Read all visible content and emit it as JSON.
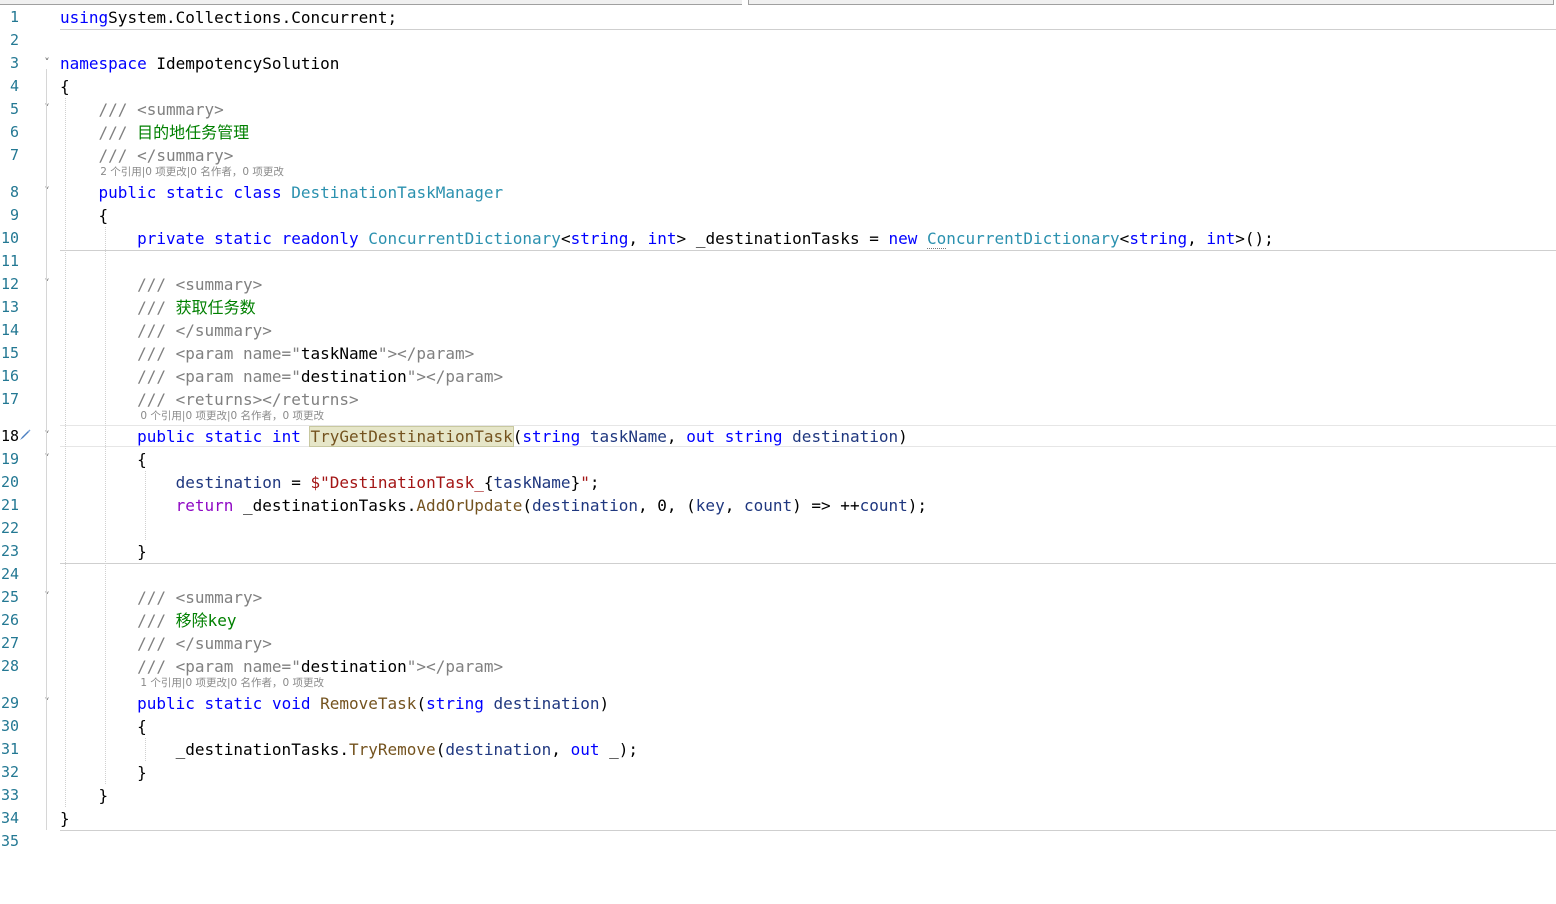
{
  "editor": {
    "current_line": 18,
    "lines": [
      {
        "n": "1",
        "tokens": [
          [
            "kw",
            "using"
          ],
          [
            "",
            "System.Collections.Concurrent;"
          ]
        ]
      },
      {
        "n": "2",
        "tokens": []
      },
      {
        "n": "3",
        "fold": true,
        "tokens": [
          [
            "kw",
            "namespace"
          ],
          [
            "",
            " IdempotencySolution"
          ]
        ]
      },
      {
        "n": "4",
        "tokens": [
          [
            "",
            "{"
          ]
        ]
      },
      {
        "n": "5",
        "fold": true,
        "tokens": [
          [
            "",
            "    "
          ],
          [
            "dx",
            "/// <summary>"
          ]
        ]
      },
      {
        "n": "6",
        "tokens": [
          [
            "",
            "    "
          ],
          [
            "dx",
            "/// "
          ],
          [
            "cm",
            "目的地任务管理"
          ]
        ]
      },
      {
        "n": "7",
        "tokens": [
          [
            "",
            "    "
          ],
          [
            "dx",
            "/// </summary>"
          ]
        ]
      },
      {
        "n": "8",
        "fold": true,
        "lens": "2 个引用|0 项更改|0 名作者，0 项更改",
        "lens_indent": 4,
        "tokens": [
          [
            "",
            "    "
          ],
          [
            "kw",
            "public"
          ],
          [
            "",
            " "
          ],
          [
            "kw",
            "static"
          ],
          [
            "",
            " "
          ],
          [
            "kw",
            "class"
          ],
          [
            "",
            " "
          ],
          [
            "ty",
            "DestinationTaskManager"
          ]
        ]
      },
      {
        "n": "9",
        "tokens": [
          [
            "",
            "    {"
          ]
        ]
      },
      {
        "n": "10",
        "tokens": [
          [
            "",
            "        "
          ],
          [
            "kw",
            "private"
          ],
          [
            "",
            " "
          ],
          [
            "kw",
            "static"
          ],
          [
            "",
            " "
          ],
          [
            "kw",
            "readonly"
          ],
          [
            "",
            " "
          ],
          [
            "ty",
            "ConcurrentDictionary"
          ],
          [
            "",
            "<"
          ],
          [
            "kw",
            "string"
          ],
          [
            ", "
          ],
          [
            "kw",
            "int"
          ],
          [
            "",
            "> _destinationTasks = "
          ],
          [
            "kw",
            "new"
          ],
          [
            "",
            " "
          ],
          [
            "ty squig",
            "Co"
          ],
          [
            "ty",
            "ncurrentDictionary"
          ],
          [
            "",
            "<"
          ],
          [
            "kw",
            "string"
          ],
          [
            ", "
          ],
          [
            "kw",
            "int"
          ],
          [
            "",
            ">();"
          ]
        ]
      },
      {
        "n": "11",
        "tokens": []
      },
      {
        "n": "12",
        "fold": true,
        "tokens": [
          [
            "",
            "        "
          ],
          [
            "dx",
            "/// <summary>"
          ]
        ]
      },
      {
        "n": "13",
        "tokens": [
          [
            "",
            "        "
          ],
          [
            "dx",
            "/// "
          ],
          [
            "cm",
            "获取任务数"
          ]
        ]
      },
      {
        "n": "14",
        "tokens": [
          [
            "",
            "        "
          ],
          [
            "dx",
            "/// </summary>"
          ]
        ]
      },
      {
        "n": "15",
        "tokens": [
          [
            "",
            "        "
          ],
          [
            "dx",
            "/// <param name=\""
          ],
          [
            "",
            "taskName"
          ],
          [
            "dx",
            "\"></param>"
          ]
        ]
      },
      {
        "n": "16",
        "tokens": [
          [
            "",
            "        "
          ],
          [
            "dx",
            "/// <param name=\""
          ],
          [
            "",
            "destination"
          ],
          [
            "dx",
            "\"></param>"
          ]
        ]
      },
      {
        "n": "17",
        "tokens": [
          [
            "",
            "        "
          ],
          [
            "dx",
            "/// <returns></returns>"
          ]
        ]
      },
      {
        "n": "18",
        "fold": true,
        "lens": "0 个引用|0 项更改|0 名作者，0 项更改",
        "lens_indent": 8,
        "tokens": [
          [
            "",
            "        "
          ],
          [
            "kw",
            "public"
          ],
          [
            "",
            " "
          ],
          [
            "kw",
            "static"
          ],
          [
            "",
            " "
          ],
          [
            "kw",
            "int"
          ],
          [
            "",
            " "
          ],
          [
            "mt hl",
            "TryGetDestinationTask"
          ],
          [
            "",
            "("
          ],
          [
            "kw",
            "string"
          ],
          [
            "",
            " "
          ],
          [
            "pm",
            "taskName"
          ],
          [
            ", "
          ],
          [
            "kw",
            "out"
          ],
          [
            "",
            " "
          ],
          [
            "kw",
            "string"
          ],
          [
            "",
            " "
          ],
          [
            "pm",
            "destination"
          ],
          [
            "",
            ")"
          ]
        ]
      },
      {
        "n": "19",
        "fold": true,
        "tokens": [
          [
            "",
            "        {"
          ]
        ]
      },
      {
        "n": "20",
        "tokens": [
          [
            "",
            "            "
          ],
          [
            "pm",
            "destination"
          ],
          [
            "",
            " = "
          ],
          [
            "st",
            "$\"DestinationTask_"
          ],
          [
            "",
            "{"
          ],
          [
            "pm",
            "taskName"
          ],
          [
            "",
            "}"
          ],
          [
            "st",
            "\""
          ],
          [
            "",
            ";"
          ]
        ]
      },
      {
        "n": "21",
        "tokens": [
          [
            "",
            "            "
          ],
          [
            "ctl",
            "return"
          ],
          [
            "",
            " _destinationTasks."
          ],
          [
            "mt",
            "AddOrUpdate"
          ],
          [
            "",
            "("
          ],
          [
            "pm",
            "destination"
          ],
          [
            "",
            ", 0, ("
          ],
          [
            "pm",
            "key"
          ],
          [
            ", "
          ],
          [
            "pm",
            "count"
          ],
          [
            "",
            ") => ++"
          ],
          [
            "pm",
            "count"
          ],
          [
            "",
            ");"
          ]
        ]
      },
      {
        "n": "22",
        "tokens": []
      },
      {
        "n": "23",
        "tokens": [
          [
            "",
            "        }"
          ]
        ]
      },
      {
        "n": "24",
        "tokens": []
      },
      {
        "n": "25",
        "fold": true,
        "tokens": [
          [
            "",
            "        "
          ],
          [
            "dx",
            "/// <summary>"
          ]
        ]
      },
      {
        "n": "26",
        "tokens": [
          [
            "",
            "        "
          ],
          [
            "dx",
            "/// "
          ],
          [
            "cm",
            "移除key"
          ]
        ]
      },
      {
        "n": "27",
        "tokens": [
          [
            "",
            "        "
          ],
          [
            "dx",
            "/// </summary>"
          ]
        ]
      },
      {
        "n": "28",
        "tokens": [
          [
            "",
            "        "
          ],
          [
            "dx",
            "/// <param name=\""
          ],
          [
            "",
            "destination"
          ],
          [
            "dx",
            "\"></param>"
          ]
        ]
      },
      {
        "n": "29",
        "fold": true,
        "lens": "1 个引用|0 项更改|0 名作者，0 项更改",
        "lens_indent": 8,
        "tokens": [
          [
            "",
            "        "
          ],
          [
            "kw",
            "public"
          ],
          [
            "",
            " "
          ],
          [
            "kw",
            "static"
          ],
          [
            "",
            " "
          ],
          [
            "kw",
            "void"
          ],
          [
            "",
            " "
          ],
          [
            "mt",
            "RemoveTask"
          ],
          [
            "",
            "("
          ],
          [
            "kw",
            "string"
          ],
          [
            "",
            " "
          ],
          [
            "pm",
            "destination"
          ],
          [
            "",
            ")"
          ]
        ]
      },
      {
        "n": "30",
        "tokens": [
          [
            "",
            "        {"
          ]
        ]
      },
      {
        "n": "31",
        "tokens": [
          [
            "",
            "            _destinationTasks."
          ],
          [
            "mt",
            "TryRemove"
          ],
          [
            "",
            "("
          ],
          [
            "pm",
            "destination"
          ],
          [
            "",
            ", "
          ],
          [
            "kw",
            "out"
          ],
          [
            "",
            " _);"
          ]
        ]
      },
      {
        "n": "32",
        "tokens": [
          [
            "",
            "        }"
          ]
        ]
      },
      {
        "n": "33",
        "tokens": [
          [
            "",
            "    }"
          ]
        ]
      },
      {
        "n": "34",
        "tokens": [
          [
            "",
            "}"
          ]
        ]
      },
      {
        "n": "35",
        "tokens": []
      }
    ]
  }
}
